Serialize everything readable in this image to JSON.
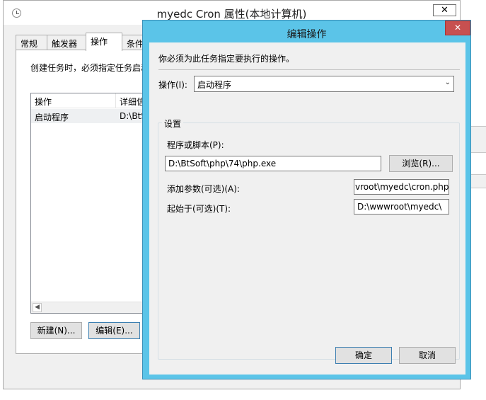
{
  "back_window": {
    "title": "myedc Cron 属性(本地计算机)",
    "close_glyph": "✕",
    "tabs": [
      "常规",
      "触发器",
      "操作",
      "条件"
    ],
    "hint": "创建任务时，必须指定任务启动",
    "list": {
      "columns": [
        "操作",
        "详细信"
      ],
      "rows": [
        {
          "action": "启动程序",
          "detail": "D:\\BtSo"
        }
      ]
    },
    "buttons": {
      "new": "新建(N)...",
      "edit": "编辑(E)..."
    }
  },
  "dialog": {
    "title": "编辑操作",
    "close_glyph": "✕",
    "note": "你必须为此任务指定要执行的操作。",
    "action_label": "操作(I):",
    "action_value": "启动程序",
    "settings_legend": "设置",
    "program_label": "程序或脚本(P):",
    "program_value": "D:\\BtSoft\\php\\74\\php.exe",
    "browse_button": "浏览(R)...",
    "args_label": "添加参数(可选)(A):",
    "args_value": "vroot\\myedc\\cron.php",
    "startin_label": "起始于(可选)(T):",
    "startin_value": "D:\\wwwroot\\myedc\\",
    "ok_button": "确定",
    "cancel_button": "取消"
  }
}
